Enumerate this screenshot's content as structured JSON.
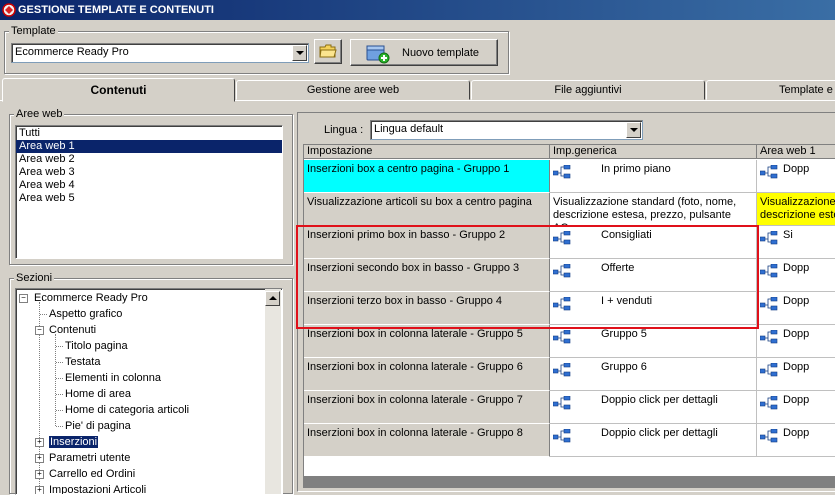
{
  "window": {
    "title": "GESTIONE TEMPLATE E CONTENUTI"
  },
  "template": {
    "group_label": "Template",
    "selected": "Ecommerce Ready Pro",
    "new_button": "Nuovo template"
  },
  "tabs": [
    {
      "label": "Contenuti",
      "active": true
    },
    {
      "label": "Gestione aree web",
      "active": false
    },
    {
      "label": "File aggiuntivi",
      "active": false
    },
    {
      "label": "Template e",
      "active": false
    }
  ],
  "aree_web": {
    "label": "Aree web",
    "items": [
      "Tutti",
      "Area web 1",
      "Area web 2",
      "Area web 3",
      "Area web 4",
      "Area web 5"
    ],
    "selected_index": 1
  },
  "sezioni": {
    "label": "Sezioni",
    "nodes": [
      {
        "label": "Ecommerce Ready Pro",
        "expander": "minus"
      },
      {
        "label": "Aspetto grafico",
        "expander": ""
      },
      {
        "label": "Contenuti",
        "expander": "minus"
      },
      {
        "label": "Titolo pagina",
        "expander": ""
      },
      {
        "label": "Testata",
        "expander": ""
      },
      {
        "label": "Elementi in colonna",
        "expander": ""
      },
      {
        "label": "Home di area",
        "expander": ""
      },
      {
        "label": "Home di categoria articoli",
        "expander": ""
      },
      {
        "label": "Pie' di pagina",
        "expander": ""
      },
      {
        "label": "Inserzioni",
        "expander": "plus"
      },
      {
        "label": "Parametri utente",
        "expander": "plus"
      },
      {
        "label": "Carrello ed Ordini",
        "expander": "plus"
      },
      {
        "label": "Impostazioni Articoli",
        "expander": "plus"
      }
    ],
    "selected_index": 9
  },
  "lingua": {
    "label": "Lingua :",
    "selected": "Lingua default"
  },
  "grid": {
    "columns": [
      "Impostazione",
      "Imp.generica",
      "Area web 1"
    ],
    "rows": [
      {
        "name": "Inserzioni box a centro pagina - Gruppo 1",
        "generic": "In primo piano",
        "area1": "Dopp",
        "highlight": "cyan"
      },
      {
        "name": "Visualizzazione articoli su box a centro pagina",
        "generic": "Visualizzazione standard (foto, nome, descrizione estesa, prezzo, pulsante AC...",
        "area1": "Visualizzazione descrizione este",
        "highlight": "yellow"
      },
      {
        "name": "Inserzioni primo box in basso - Gruppo 2",
        "generic": "Consigliati",
        "area1": "Si"
      },
      {
        "name": "Inserzioni secondo box in basso - Gruppo 3",
        "generic": "Offerte",
        "area1": "Dopp"
      },
      {
        "name": "Inserzioni terzo box in basso - Gruppo 4",
        "generic": "I + venduti",
        "area1": "Dopp"
      },
      {
        "name": "Inserzioni box in colonna laterale - Gruppo 5",
        "generic": "Gruppo 5",
        "area1": "Dopp"
      },
      {
        "name": "Inserzioni box in colonna laterale - Gruppo 6",
        "generic": "Gruppo 6",
        "area1": "Dopp"
      },
      {
        "name": "Inserzioni box in colonna laterale - Gruppo 7",
        "generic": "Doppio click per dettagli",
        "area1": "Dopp"
      },
      {
        "name": "Inserzioni box in colonna laterale - Gruppo 8",
        "generic": "Doppio click per dettagli",
        "area1": "Dopp"
      }
    ]
  },
  "colors": {
    "title_bar": "#0a246a",
    "selection": "#0a246a",
    "cyan_row": "#00ffff",
    "yellow_cell": "#ffff00",
    "annotation": "#e0101a"
  }
}
